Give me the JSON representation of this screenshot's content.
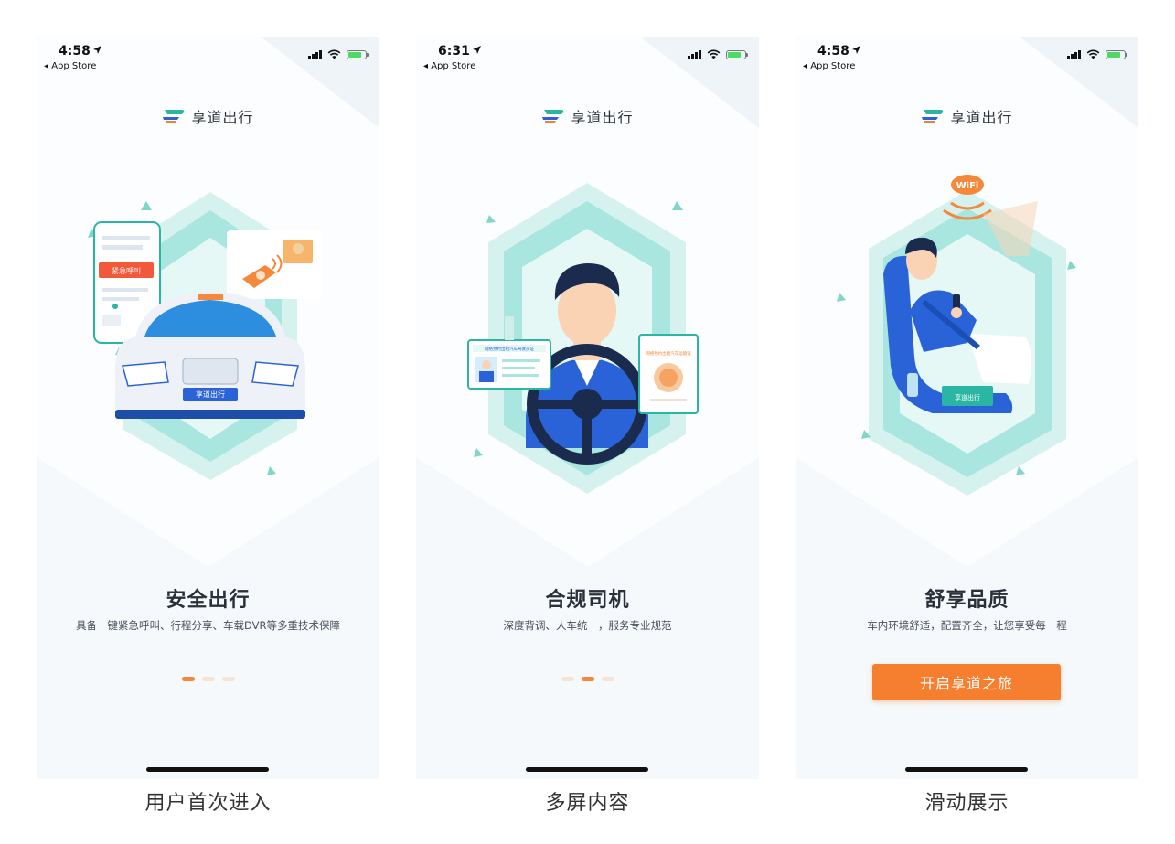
{
  "screens": [
    {
      "time": "4:58",
      "back_label": "◂ App Store",
      "logo_text": "享道出行",
      "title": "安全出行",
      "description": "具备一键紧急呼叫、行程分享、车载DVR等多重技术保障",
      "page_index": 0,
      "emergency_label": "紧急呼叫",
      "plate_text": "享道出行",
      "dvr_label": "DVR",
      "caption": "用户首次进入"
    },
    {
      "time": "6:31",
      "back_label": "◂ App Store",
      "logo_text": "享道出行",
      "title": "合规司机",
      "description": "深度背调、人车统一，服务专业规范",
      "page_index": 1,
      "license_text": "网络预约出租汽车驾驶员证",
      "cert_text": "网络预约出租汽车运输证",
      "caption": "多屏内容"
    },
    {
      "time": "4:58",
      "back_label": "◂ App Store",
      "logo_text": "享道出行",
      "title": "舒享品质",
      "description": "车内环境舒适，配置齐全，让您享受每一程",
      "wifi_label": "WiFi",
      "tissue_label": "享道出行",
      "cta_label": "开启享道之旅",
      "caption": "滑动展示"
    }
  ],
  "colors": {
    "accent_orange": "#f57f2f",
    "brand_teal": "#2bb5a3",
    "brand_blue": "#2a63d8",
    "hex_teal": "#a9e6df",
    "text_dark": "#2a2f3a"
  },
  "icons": [
    "location-arrow-icon",
    "signal-icon",
    "wifi-icon",
    "battery-icon",
    "brand-logo-icon"
  ]
}
